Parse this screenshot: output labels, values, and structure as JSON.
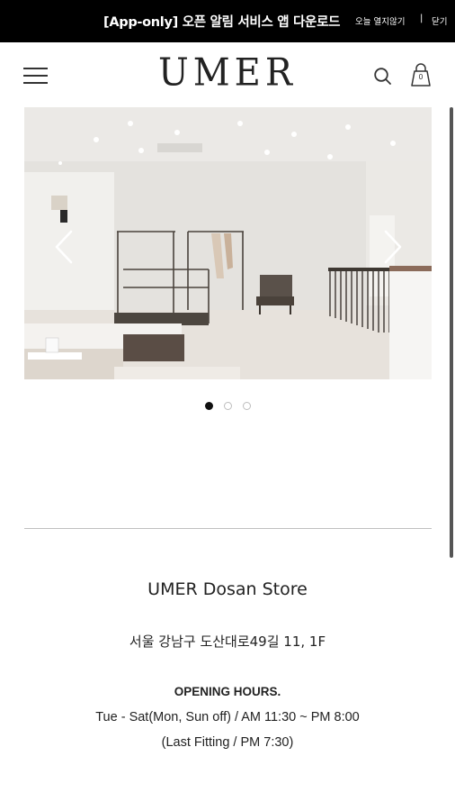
{
  "promo_banner": {
    "text": "[App-only] 오픈 알림 서비스 앱 다운로드",
    "hide_today_label": "오늘 열지않기",
    "separator": "|",
    "close_label": "닫기",
    "background_color": "#000000"
  },
  "header": {
    "logo": "UMER",
    "menu_icon": "hamburger-menu-icon",
    "search_icon": "search-icon",
    "cart_icon": "shopping-bag-icon",
    "cart_count": "0"
  },
  "slider": {
    "total_slides": 3,
    "active_index": 0,
    "prev_icon": "chevron-left-icon",
    "next_icon": "chevron-right-icon"
  },
  "store": {
    "name": "UMER Dosan Store",
    "address": "서울 강남구 도산대로49길 11, 1F",
    "hours_title": "OPENING HOURS.",
    "hours_line1": "Tue - Sat(Mon, Sun off) / AM 11:30 ~ PM 8:00",
    "hours_line2": "(Last Fitting / PM 7:30)"
  }
}
